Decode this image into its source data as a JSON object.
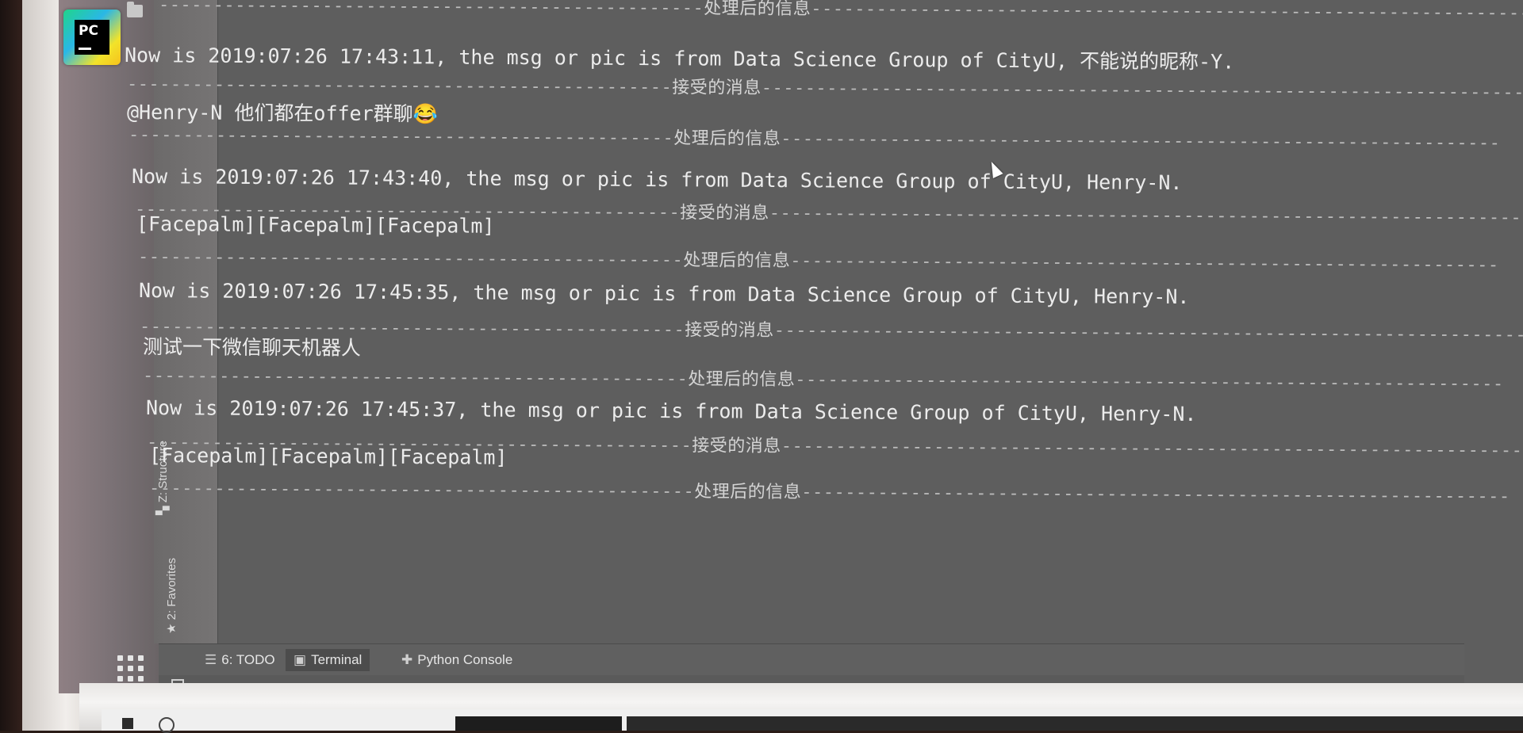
{
  "console": {
    "lines": [
      {
        "type": "sep",
        "dashes_left": "--------------------------------------------------",
        "label": "处理后的信息",
        "dashes_right": "-------------------------------------------------------------------"
      },
      {
        "type": "msg",
        "text": "Now is 2019:07:26 17:43:11, the msg or pic is from Data Science Group of CityU, 不能说的昵称-Y."
      },
      {
        "type": "sep",
        "dashes_left": "--------------------------------------------------",
        "label": "接受的消息",
        "dashes_right": "------------------------------------------------------------------------"
      },
      {
        "type": "msg",
        "text": "@Henry-N 他们都在offer群聊😂"
      },
      {
        "type": "sep",
        "dashes_left": "--------------------------------------------------",
        "label": "处理后的信息",
        "dashes_right": "------------------------------------------------------------------"
      },
      {
        "type": "msg",
        "text": "Now is 2019:07:26 17:43:40, the msg or pic is from Data Science Group of CityU, Henry-N."
      },
      {
        "type": "sep",
        "dashes_left": "--------------------------------------------------",
        "label": "接受的消息",
        "dashes_right": "----------------------------------------------------------------------"
      },
      {
        "type": "msg",
        "text": "[Facepalm][Facepalm][Facepalm]"
      },
      {
        "type": "sep",
        "dashes_left": "--------------------------------------------------",
        "label": "处理后的信息",
        "dashes_right": "-----------------------------------------------------------------"
      },
      {
        "type": "msg",
        "text": "Now is 2019:07:26 17:45:35, the msg or pic is from Data Science Group of CityU, Henry-N."
      },
      {
        "type": "sep",
        "dashes_left": "--------------------------------------------------",
        "label": "接受的消息",
        "dashes_right": "----------------------------------------------------------------------"
      },
      {
        "type": "msg",
        "text": "测试一下微信聊天机器人"
      },
      {
        "type": "sep",
        "dashes_left": "--------------------------------------------------",
        "label": "处理后的信息",
        "dashes_right": "-----------------------------------------------------------------"
      },
      {
        "type": "msg",
        "text": "Now is 2019:07:26 17:45:37, the msg or pic is from Data Science Group of CityU, Henry-N."
      },
      {
        "type": "sep",
        "dashes_left": "--------------------------------------------------",
        "label": "接受的消息",
        "dashes_right": "----------------------------------------------------------------------"
      },
      {
        "type": "msg",
        "text": "[Facepalm][Facepalm][Facepalm]"
      },
      {
        "type": "sep",
        "dashes_left": "--------------------------------------------------",
        "label": "处理后的信息",
        "dashes_right": "-----------------------------------------------------------------"
      }
    ]
  },
  "side_tabs": {
    "structure": "Z: Structure",
    "favorites": "2: Favorites"
  },
  "bottom_tabs": {
    "todo": "6: TODO",
    "terminal": "Terminal",
    "python_console": "Python Console"
  },
  "logo": {
    "text": "PC"
  },
  "icons": {
    "structure": "structure-icon",
    "favorites": "star-icon",
    "todo": "list-icon",
    "terminal": "terminal-icon",
    "python_console": "python-icon"
  }
}
